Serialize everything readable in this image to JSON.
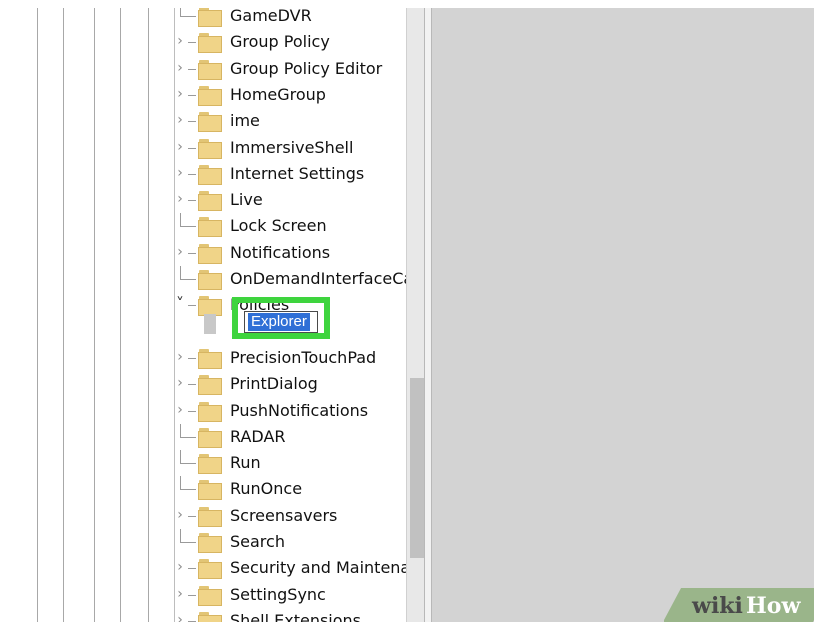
{
  "tree": {
    "items": [
      {
        "label": "GameDVR",
        "expandable": false
      },
      {
        "label": "Group Policy",
        "expandable": true
      },
      {
        "label": "Group Policy Editor",
        "expandable": true
      },
      {
        "label": "HomeGroup",
        "expandable": true
      },
      {
        "label": "ime",
        "expandable": true
      },
      {
        "label": "ImmersiveShell",
        "expandable": true
      },
      {
        "label": "Internet Settings",
        "expandable": true
      },
      {
        "label": "Live",
        "expandable": true
      },
      {
        "label": "Lock Screen",
        "expandable": false
      },
      {
        "label": "Notifications",
        "expandable": true
      },
      {
        "label": "OnDemandInterfaceCa",
        "expandable": false
      },
      {
        "label": "Policies",
        "expandable": true,
        "expanded": true
      },
      {
        "label": "PrecisionTouchPad",
        "expandable": true
      },
      {
        "label": "PrintDialog",
        "expandable": true
      },
      {
        "label": "PushNotifications",
        "expandable": true
      },
      {
        "label": "RADAR",
        "expandable": false
      },
      {
        "label": "Run",
        "expandable": false
      },
      {
        "label": "RunOnce",
        "expandable": false
      },
      {
        "label": "Screensavers",
        "expandable": true
      },
      {
        "label": "Search",
        "expandable": false
      },
      {
        "label": "Security and Maintenar",
        "expandable": true
      },
      {
        "label": "SettingSync",
        "expandable": true
      },
      {
        "label": "Shell Extensions",
        "expandable": true
      }
    ],
    "new_key_edit_value": "Explorer"
  },
  "icons": {
    "expander_collapsed": "chevron-right-icon",
    "expander_expanded": "chevron-down-icon",
    "folder": "folder-icon"
  },
  "colors": {
    "highlight_box": "#3ed43e",
    "selection": "#2f6fd6",
    "folder": "#f0d488",
    "values_pane": "#d3d3d3"
  },
  "watermark": {
    "wiki": "wiki",
    "how": "How"
  }
}
